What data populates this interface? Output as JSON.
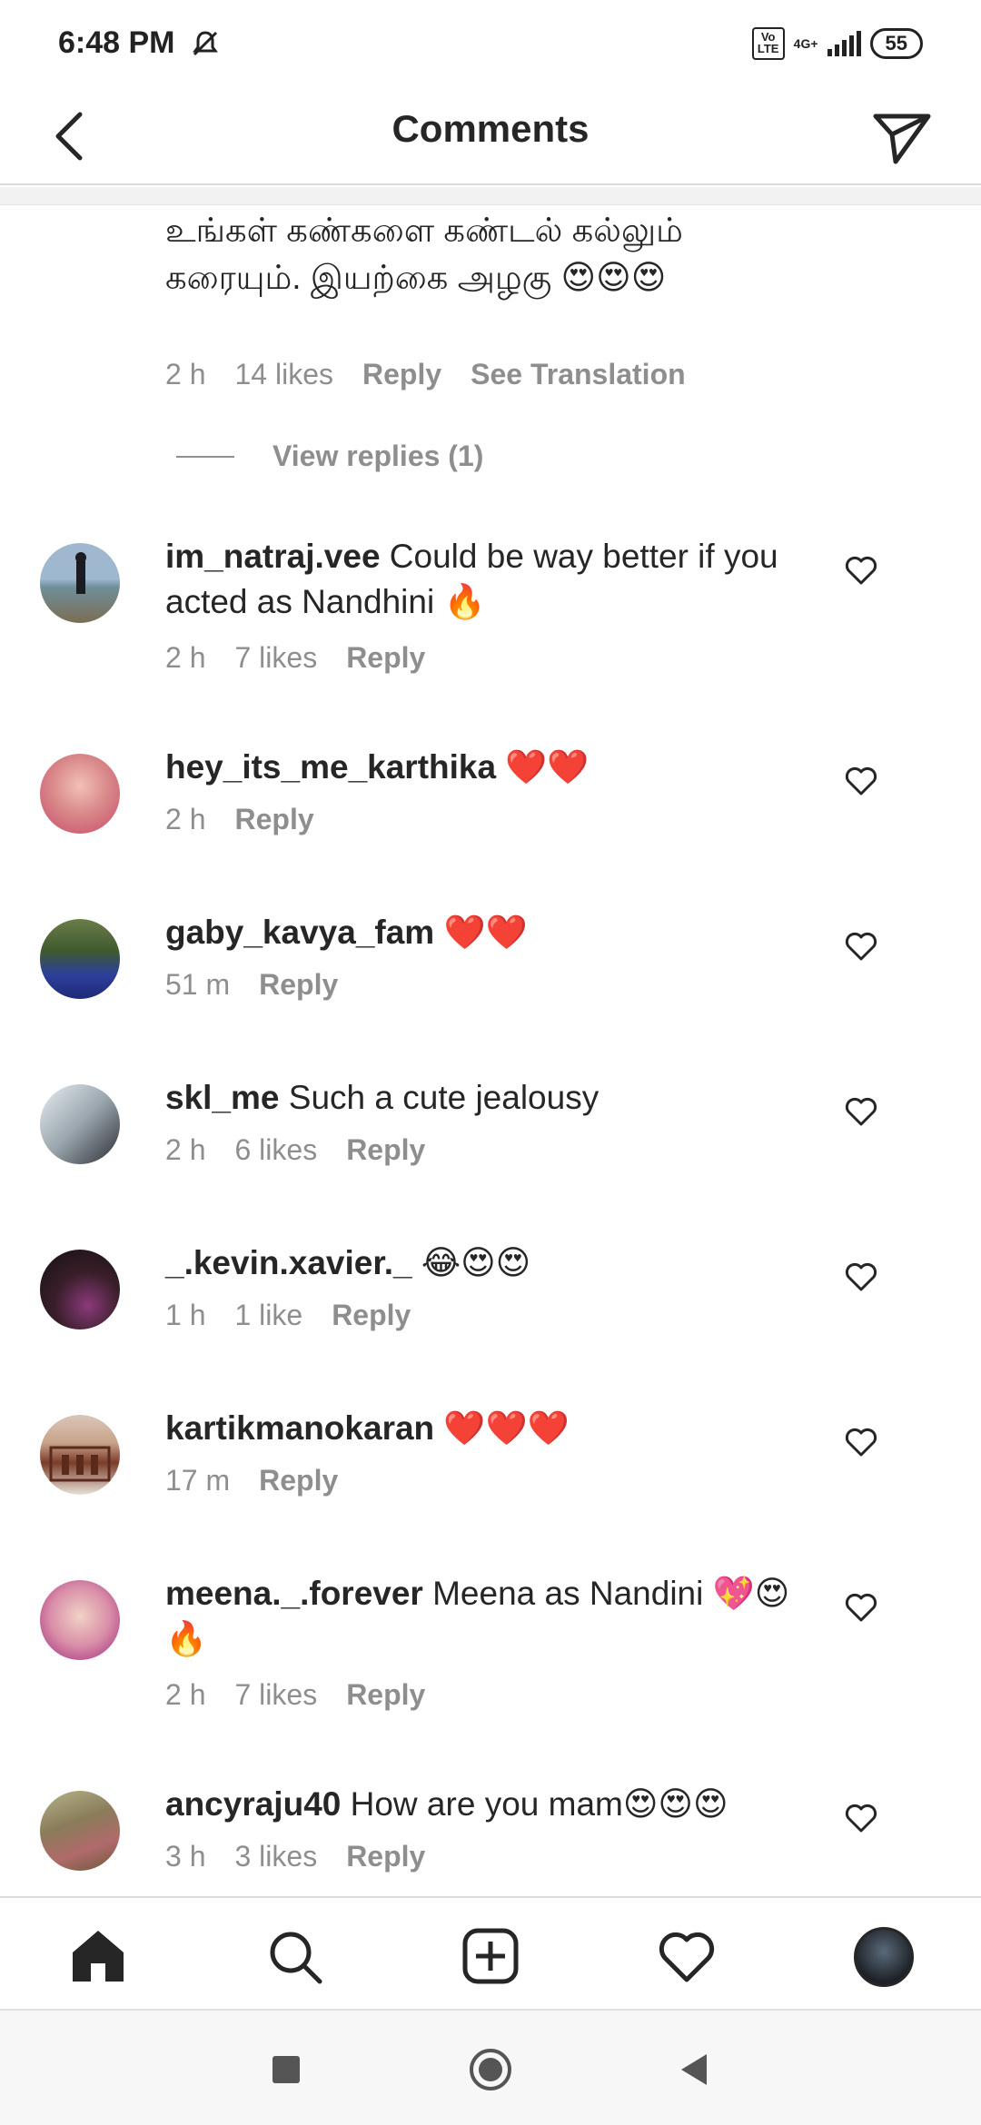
{
  "status_bar": {
    "time": "6:48 PM",
    "volte": "Vo LTE",
    "network": "4G+",
    "battery": "55"
  },
  "header": {
    "title": "Comments",
    "back_icon": "back-arrow-icon",
    "send_icon": "paper-plane-icon"
  },
  "top_comment": {
    "text": "உங்கள் கண்களை கண்டல் கல்லும் கரையும். இயற்கை அழகு 😍😍😍",
    "time": "2 h",
    "likes": "14 likes",
    "reply": "Reply",
    "translate": "See Translation",
    "view_replies": "View replies (1)"
  },
  "comments": [
    {
      "username": "im_natraj.vee",
      "text": " Could be way better if you acted as Nandhini 🔥",
      "time": "2 h",
      "likes": "7 likes",
      "reply": "Reply"
    },
    {
      "username": "hey_its_me_karthika",
      "text": " ❤️❤️",
      "time": "2 h",
      "likes": "",
      "reply": "Reply"
    },
    {
      "username": "gaby_kavya_fam",
      "text": " ❤️❤️",
      "time": "51 m",
      "likes": "",
      "reply": "Reply"
    },
    {
      "username": "skl_me",
      "text": " Such a cute jealousy",
      "time": "2 h",
      "likes": "6 likes",
      "reply": "Reply"
    },
    {
      "username": "_.kevin.xavier._",
      "text": " 😂😍😍",
      "time": "1 h",
      "likes": "1 like",
      "reply": "Reply"
    },
    {
      "username": "kartikmanokaran",
      "text": " ❤️❤️❤️",
      "time": "17 m",
      "likes": "",
      "reply": "Reply"
    },
    {
      "username": "meena._.forever",
      "text": " Meena as Nandini 💖😍🔥",
      "time": "2 h",
      "likes": "7 likes",
      "reply": "Reply"
    },
    {
      "username": "ancyraju40",
      "text": " How are you mam😍😍😍",
      "time": "3 h",
      "likes": "3 likes",
      "reply": "Reply"
    }
  ],
  "bottom_nav": [
    "home-icon",
    "search-icon",
    "add-post-icon",
    "activity-heart-icon",
    "profile-avatar"
  ],
  "system_nav": [
    "recents-square-icon",
    "home-circle-icon",
    "back-triangle-icon"
  ],
  "colors": {
    "text": "#262626",
    "secondary": "#8e8e8e",
    "divider": "#dbdbdb"
  }
}
